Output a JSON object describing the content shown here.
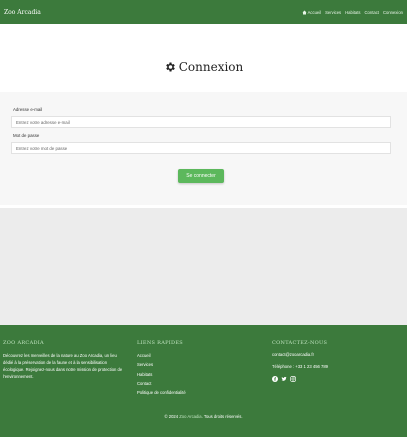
{
  "nav": {
    "brand": "Zoo Arcadia",
    "links": [
      "Accueil",
      "Services",
      "Habitats",
      "Contact",
      "Connexion"
    ]
  },
  "login": {
    "title": "Connexion",
    "email_label": "Adresse e-mail",
    "email_placeholder": "Entrez votre adresse e-mail",
    "password_label": "Mot de passe",
    "password_placeholder": "Entrez votre mot de passe",
    "submit_label": "Se connecter"
  },
  "footer": {
    "about_title": "ZOO ARCADIA",
    "about_text": "Découvrez les merveilles de la nature au Zoo Arcadia, un lieu dédié à la préservation de la faune et à la sensibilisation écologique. Rejoignez-nous dans notre mission de protection de l'environnement.",
    "quick_title": "LIENS RAPIDES",
    "quick_links": [
      "Accueil",
      "Services",
      "Habitats",
      "Contact",
      "Politique de confidentialité"
    ],
    "contact_title": "CONTACTEZ-NOUS",
    "email": "contact@zooarcadia.fr",
    "phone": "Téléphone : +33 1 23 456 789",
    "copyright_prefix": "© 2024",
    "copyright_brand": "Zoo Arcadia",
    "copyright_suffix": ". Tous droits réservés."
  },
  "colors": {
    "primary": "#3c7a3c",
    "button": "#5cb85c",
    "footer_heading": "#bfe3bf"
  },
  "icons": [
    "gear-icon",
    "home-icon",
    "facebook-icon",
    "twitter-icon",
    "instagram-icon"
  ]
}
